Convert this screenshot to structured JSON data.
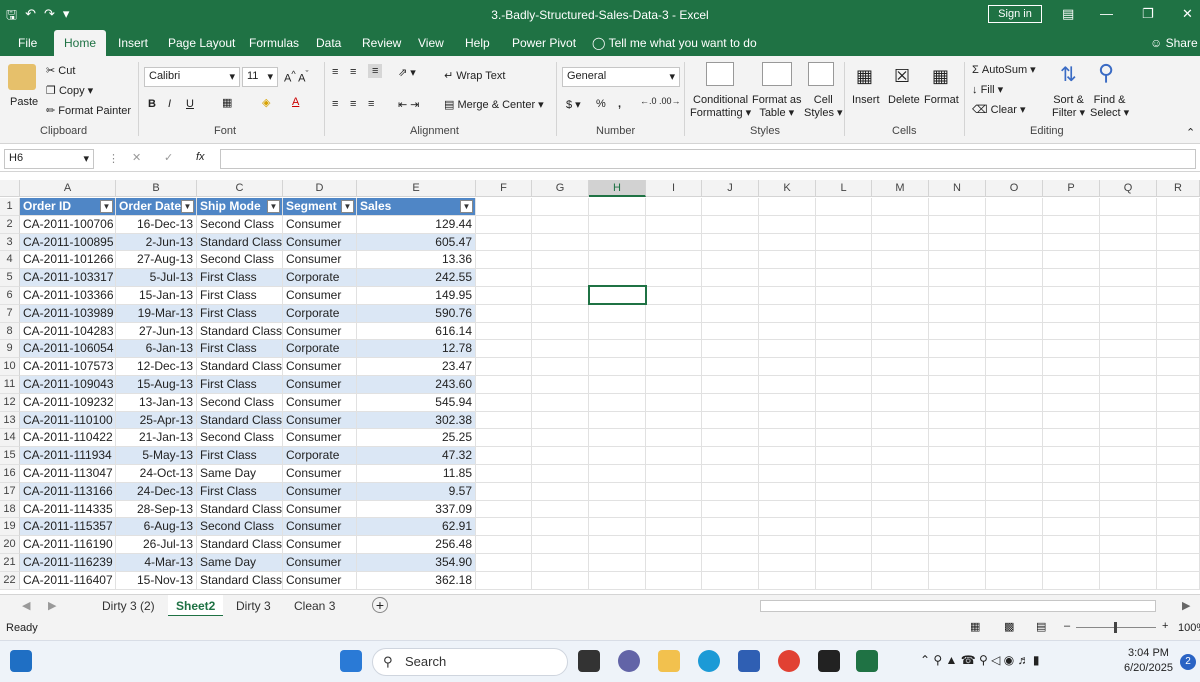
{
  "window": {
    "title": "3.-Badly-Structured-Sales-Data-3  -  Excel",
    "sign_in": "Sign in",
    "share": "Share"
  },
  "menu": [
    "File",
    "Home",
    "Insert",
    "Page Layout",
    "Formulas",
    "Data",
    "Review",
    "View",
    "Help",
    "Power Pivot"
  ],
  "tell_me": "Tell me what you want to do",
  "ribbon": {
    "clipboard": {
      "paste": "Paste",
      "cut": "Cut",
      "copy": "Copy",
      "format_painter": "Format Painter",
      "label": "Clipboard"
    },
    "font": {
      "name": "Calibri",
      "size": "11",
      "label": "Font"
    },
    "alignment": {
      "wrap": "Wrap Text",
      "merge": "Merge & Center",
      "label": "Alignment"
    },
    "number": {
      "format": "General",
      "currency": "$",
      "percent": "%",
      "comma": ",",
      "label": "Number"
    },
    "styles": {
      "conditional": "Conditional",
      "formatting": "Formatting",
      "format_as": "Format as",
      "table": "Table",
      "cell": "Cell",
      "cell_styles": "Styles",
      "label": "Styles"
    },
    "cells": {
      "insert": "Insert",
      "delete": "Delete",
      "format": "Format",
      "label": "Cells"
    },
    "editing": {
      "autosum": "AutoSum",
      "fill": "Fill",
      "clear": "Clear",
      "sort": "Sort &",
      "filter": "Filter",
      "find": "Find &",
      "select": "Select",
      "label": "Editing"
    }
  },
  "formula_bar": {
    "name_box": "H6",
    "fx": "fx",
    "value": ""
  },
  "columns": [
    "A",
    "B",
    "C",
    "D",
    "E",
    "F",
    "G",
    "H",
    "I",
    "J",
    "K",
    "L",
    "M",
    "N",
    "O",
    "P",
    "Q",
    "R"
  ],
  "selected_column": "H",
  "headers": [
    "Order ID",
    "Order Date",
    "Ship Mode",
    "Segment",
    "Sales"
  ],
  "rows": [
    [
      "CA-2011-100706",
      "16-Dec-13",
      "Second Class",
      "Consumer",
      "129.44"
    ],
    [
      "CA-2011-100895",
      "2-Jun-13",
      "Standard Class",
      "Consumer",
      "605.47"
    ],
    [
      "CA-2011-101266",
      "27-Aug-13",
      "Second Class",
      "Consumer",
      "13.36"
    ],
    [
      "CA-2011-103317",
      "5-Jul-13",
      "First Class",
      "Corporate",
      "242.55"
    ],
    [
      "CA-2011-103366",
      "15-Jan-13",
      "First Class",
      "Consumer",
      "149.95"
    ],
    [
      "CA-2011-103989",
      "19-Mar-13",
      "First Class",
      "Corporate",
      "590.76"
    ],
    [
      "CA-2011-104283",
      "27-Jun-13",
      "Standard Class",
      "Consumer",
      "616.14"
    ],
    [
      "CA-2011-106054",
      "6-Jan-13",
      "First Class",
      "Corporate",
      "12.78"
    ],
    [
      "CA-2011-107573",
      "12-Dec-13",
      "Standard Class",
      "Consumer",
      "23.47"
    ],
    [
      "CA-2011-109043",
      "15-Aug-13",
      "First Class",
      "Consumer",
      "243.60"
    ],
    [
      "CA-2011-109232",
      "13-Jan-13",
      "Second Class",
      "Consumer",
      "545.94"
    ],
    [
      "CA-2011-110100",
      "25-Apr-13",
      "Standard Class",
      "Consumer",
      "302.38"
    ],
    [
      "CA-2011-110422",
      "21-Jan-13",
      "Second Class",
      "Consumer",
      "25.25"
    ],
    [
      "CA-2011-111934",
      "5-May-13",
      "First Class",
      "Corporate",
      "47.32"
    ],
    [
      "CA-2011-113047",
      "24-Oct-13",
      "Same Day",
      "Consumer",
      "11.85"
    ],
    [
      "CA-2011-113166",
      "24-Dec-13",
      "First Class",
      "Consumer",
      "9.57"
    ],
    [
      "CA-2011-114335",
      "28-Sep-13",
      "Standard Class",
      "Consumer",
      "337.09"
    ],
    [
      "CA-2011-115357",
      "6-Aug-13",
      "Second Class",
      "Consumer",
      "62.91"
    ],
    [
      "CA-2011-116190",
      "26-Jul-13",
      "Standard Class",
      "Consumer",
      "256.48"
    ],
    [
      "CA-2011-116239",
      "4-Mar-13",
      "Same Day",
      "Consumer",
      "354.90"
    ],
    [
      "CA-2011-116407",
      "15-Nov-13",
      "Standard Class",
      "Consumer",
      "362.18"
    ]
  ],
  "sheets": [
    "Dirty 3 (2)",
    "Sheet2",
    "Dirty 3",
    "Clean 3"
  ],
  "active_sheet": "Sheet2",
  "status": {
    "mode": "Ready",
    "zoom": "100%"
  },
  "taskbar": {
    "search": "Search",
    "time": "3:04 PM",
    "date": "6/20/2025",
    "badge": "2"
  },
  "colors": {
    "excel_green": "#1f7244",
    "table_header": "#4f86c6",
    "table_band": "#dbe7f5"
  }
}
